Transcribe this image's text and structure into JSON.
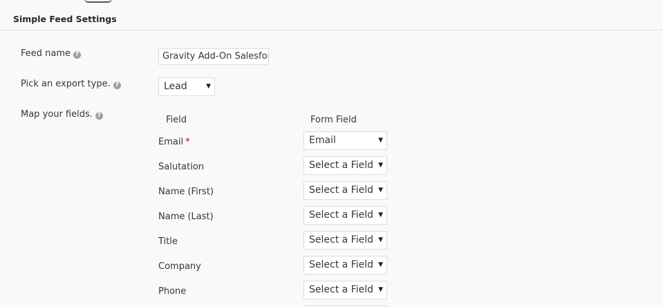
{
  "section_title": "Simple Feed Settings",
  "feed_name": {
    "label": "Feed name",
    "value": "Gravity Add-On Salesfor"
  },
  "export_type": {
    "label": "Pick an export type.",
    "value": "Lead"
  },
  "map_fields": {
    "label": "Map your fields.",
    "col_field": "Field",
    "col_form_field": "Form Field",
    "rows": [
      {
        "field": "Email",
        "required": "*",
        "form_field": "Email"
      },
      {
        "field": "Salutation",
        "required": "",
        "form_field": "Select a Field"
      },
      {
        "field": "Name (First)",
        "required": "",
        "form_field": "Select a Field"
      },
      {
        "field": "Name (Last)",
        "required": "",
        "form_field": "Select a Field"
      },
      {
        "field": "Title",
        "required": "",
        "form_field": "Select a Field"
      },
      {
        "field": "Company",
        "required": "",
        "form_field": "Select a Field"
      },
      {
        "field": "Phone",
        "required": "",
        "form_field": "Select a Field"
      }
    ]
  },
  "icons": {
    "help": "question-circle-icon",
    "dropdown": "chevron-down-icon"
  },
  "colors": {
    "panel_bg": "#f9f9f9",
    "required": "#cc0000",
    "help_icon": "#9aa0a6"
  }
}
